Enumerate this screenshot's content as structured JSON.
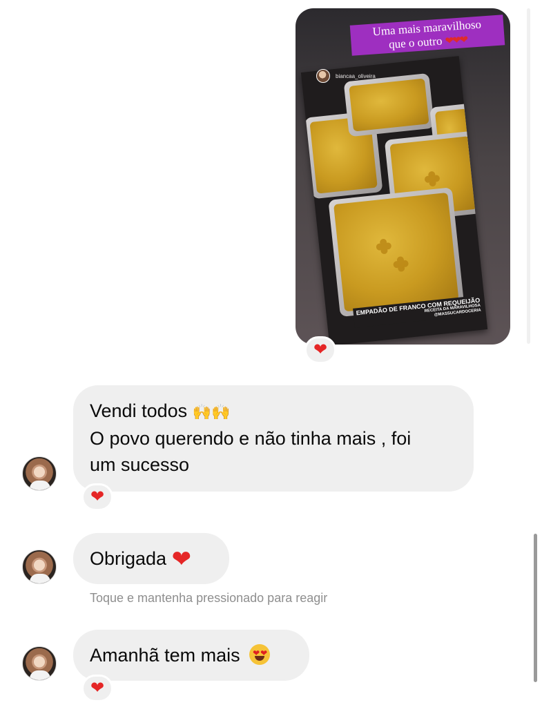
{
  "story": {
    "caption_line1": "Uma mais maravilhoso",
    "caption_line2": "que o outro",
    "caption_hearts": "❤❤❤",
    "username": "biancaa_oliveira",
    "label_main": "EMPADÃO DE FRANCO COM REQUEIJÃO",
    "label_sub1": "RECEITA DA MARAVILHOSA",
    "label_sub2": "@MASSUCARDOCERIA",
    "reaction": "❤"
  },
  "messages": [
    {
      "lines": [
        "Vendi todos",
        "O povo querendo e não tinha mais , foi",
        "um sucesso"
      ],
      "emoji": "🙌🙌",
      "reaction": "❤"
    },
    {
      "text": "Obrigada",
      "emoji": "❤"
    },
    {
      "text": "Amanhã tem mais",
      "emoji_name": "heart-eyes-face"
    }
  ],
  "reaction_hint": "Toque e mantenha pressionado para reagir",
  "last_reaction": "❤",
  "colors": {
    "bubble": "#efefef",
    "heart": "#e52626",
    "caption_bg": "#9e2fc0",
    "hint_text": "#8e8e8e"
  }
}
